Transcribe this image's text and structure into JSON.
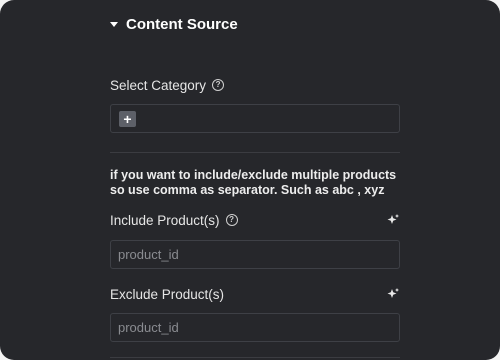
{
  "section": {
    "title": "Content Source"
  },
  "category": {
    "label": "Select Category",
    "add_label": "+"
  },
  "note": {
    "line1": "if you want to include/exclude multiple products",
    "line2": "so use comma as separator. Such as abc , xyz"
  },
  "include": {
    "label": "Include Product(s)",
    "placeholder": "product_id"
  },
  "exclude": {
    "label": "Exclude Product(s)",
    "placeholder": "product_id"
  },
  "help_glyph": "?"
}
